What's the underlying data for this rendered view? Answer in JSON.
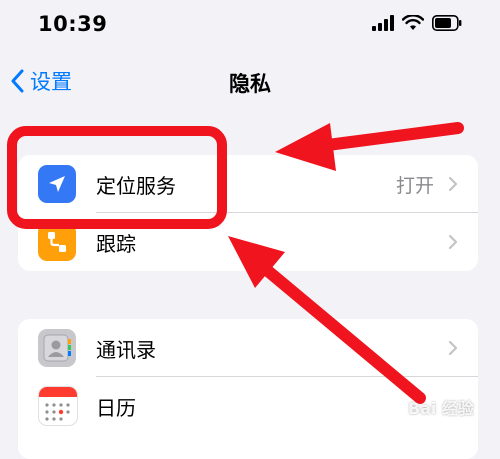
{
  "status_bar": {
    "time": "10:39",
    "icons": [
      "signal-icon",
      "wifi-icon",
      "battery-icon"
    ]
  },
  "nav": {
    "back_label": "设置",
    "title": "隐私"
  },
  "groups": [
    {
      "rows": [
        {
          "label": "定位服务",
          "value": "打开",
          "icon": "location-arrow-icon",
          "icon_color": "#3478f6"
        },
        {
          "label": "跟踪",
          "value": "",
          "icon": "tracking-icon",
          "icon_color": "#ff9f0a"
        }
      ]
    },
    {
      "rows": [
        {
          "label": "通讯录",
          "value": "",
          "icon": "contacts-icon",
          "icon_color": "#8e8e93"
        },
        {
          "label": "日历",
          "value": "",
          "icon": "calendar-icon",
          "icon_color": "#ffffff"
        }
      ]
    }
  ],
  "colors": {
    "accent": "#007aff",
    "annotation": "#f0141e",
    "background": "#f2f2f7"
  },
  "watermark": "Bai 经验"
}
